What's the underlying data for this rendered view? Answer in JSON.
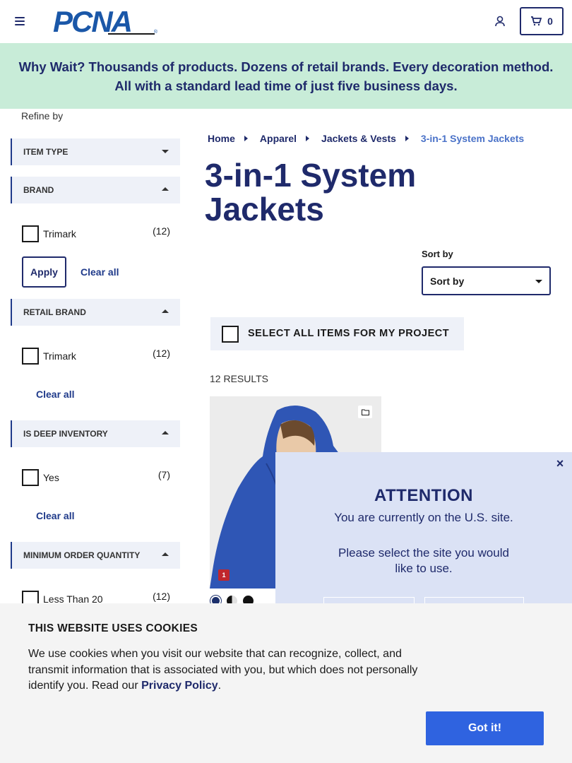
{
  "header": {
    "logo_text": "PCNA",
    "logo_mark": "®",
    "cart_count": "0"
  },
  "banner": {
    "text": "Why Wait? Thousands of products. Dozens of retail brands. Every decoration method. All with a standard lead time of just five business days."
  },
  "sidebar": {
    "refine_label": "Refine by",
    "facets": [
      {
        "title": "ITEM TYPE",
        "expanded": false
      },
      {
        "title": "BRAND",
        "expanded": true,
        "options": [
          {
            "label": "Trimark",
            "count": "(12)"
          }
        ],
        "apply_label": "Apply",
        "clear_label": "Clear all"
      },
      {
        "title": "RETAIL BRAND",
        "expanded": true,
        "options": [
          {
            "label": "Trimark",
            "count": "(12)"
          }
        ],
        "clear_label": "Clear all"
      },
      {
        "title": "IS DEEP INVENTORY",
        "expanded": true,
        "options": [
          {
            "label": "Yes",
            "count": "(7)"
          }
        ],
        "clear_label": "Clear all"
      },
      {
        "title": "MINIMUM ORDER QUANTITY",
        "expanded": true,
        "options": [
          {
            "label": "Less Than 20",
            "count": "(12)"
          }
        ]
      }
    ]
  },
  "breadcrumb": [
    "Home",
    "Apparel",
    "Jackets & Vests",
    "3-in-1 System Jackets"
  ],
  "page_title": "3-in-1 System Jackets",
  "sort": {
    "label": "Sort by",
    "value": "Sort by"
  },
  "select_all_label": "SELECT ALL ITEMS FOR MY PROJECT",
  "results_label": "12 RESULTS",
  "product": {
    "badge": "1",
    "swatch_colors": [
      "#1b2f6b",
      "#d9d9d9",
      "#111111"
    ]
  },
  "attention_modal": {
    "close": "×",
    "title": "ATTENTION",
    "line1": "You are currently on the U.S. site.",
    "line2": "Please select the site you would like to use."
  },
  "cookie_banner": {
    "title": "THIS WEBSITE USES COOKIES",
    "text_before_link": "We use cookies when you visit our website that can recognize, collect, and transmit information that is associated with you, but which does not personally identify you. Read our ",
    "link_text": "Privacy Policy",
    "text_after_link": ".",
    "button_label": "Got it!"
  },
  "colors": {
    "navy": "#1f2a6b",
    "banner_bg": "#c8ecd8",
    "facet_bg": "#eef1f8",
    "modal_bg": "#dbe2f5",
    "accent_blue": "#2f63e0"
  }
}
